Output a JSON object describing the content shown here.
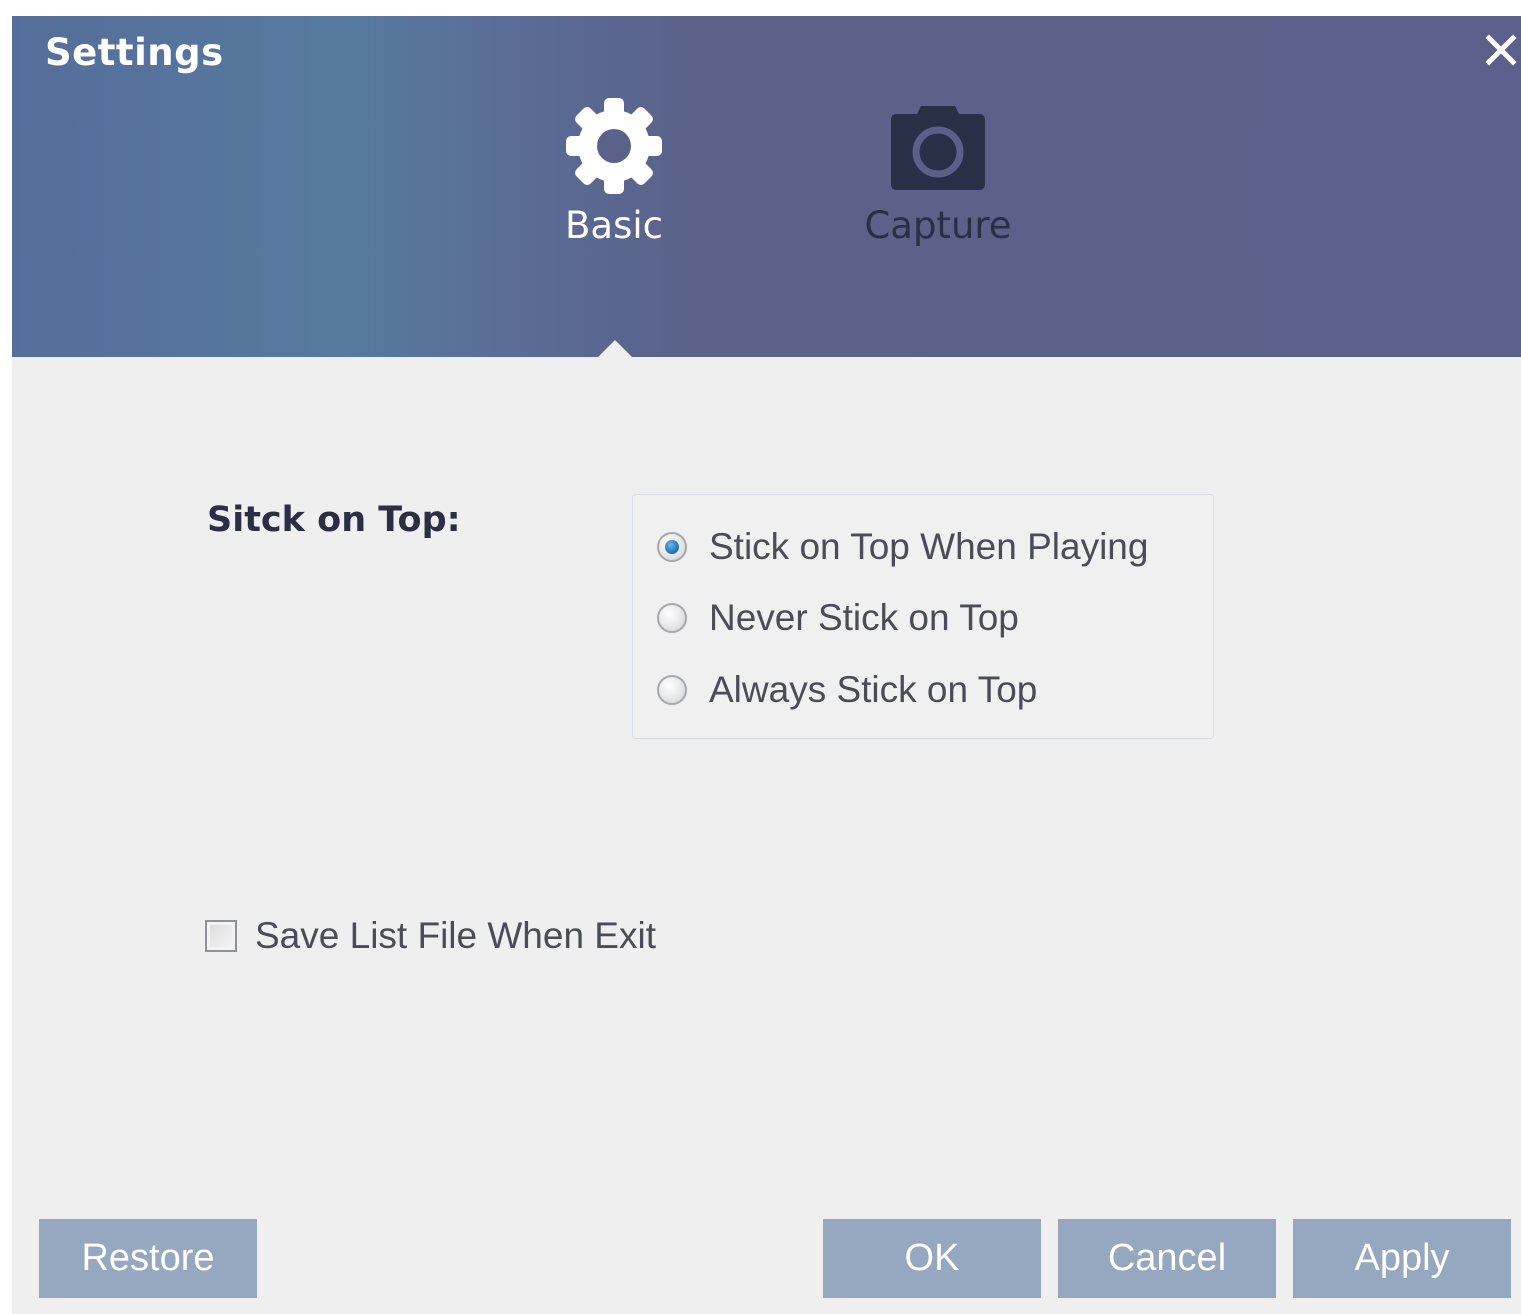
{
  "window": {
    "title": "Settings",
    "close_icon": "close-icon"
  },
  "tabs": [
    {
      "label": "Basic",
      "icon": "gear-icon",
      "selected": true
    },
    {
      "label": "Capture",
      "icon": "camera-icon",
      "selected": false
    }
  ],
  "basic": {
    "stick_on_top": {
      "label": "Sitck on  Top:",
      "options": [
        {
          "label": "Stick on Top When Playing",
          "checked": true
        },
        {
          "label": "Never Stick on Top",
          "checked": false
        },
        {
          "label": "Always Stick on Top",
          "checked": false
        }
      ]
    },
    "save_list": {
      "label": "Save List File When Exit",
      "checked": false
    }
  },
  "buttons": {
    "restore": "Restore",
    "ok": "OK",
    "cancel": "Cancel",
    "apply": "Apply"
  },
  "colors": {
    "header": "#5a6089",
    "header_accent": "#567aa0",
    "button": "#95a8c0",
    "radio_selected": "#2b7bbd",
    "capture_tab_text": "#2a2f48"
  }
}
